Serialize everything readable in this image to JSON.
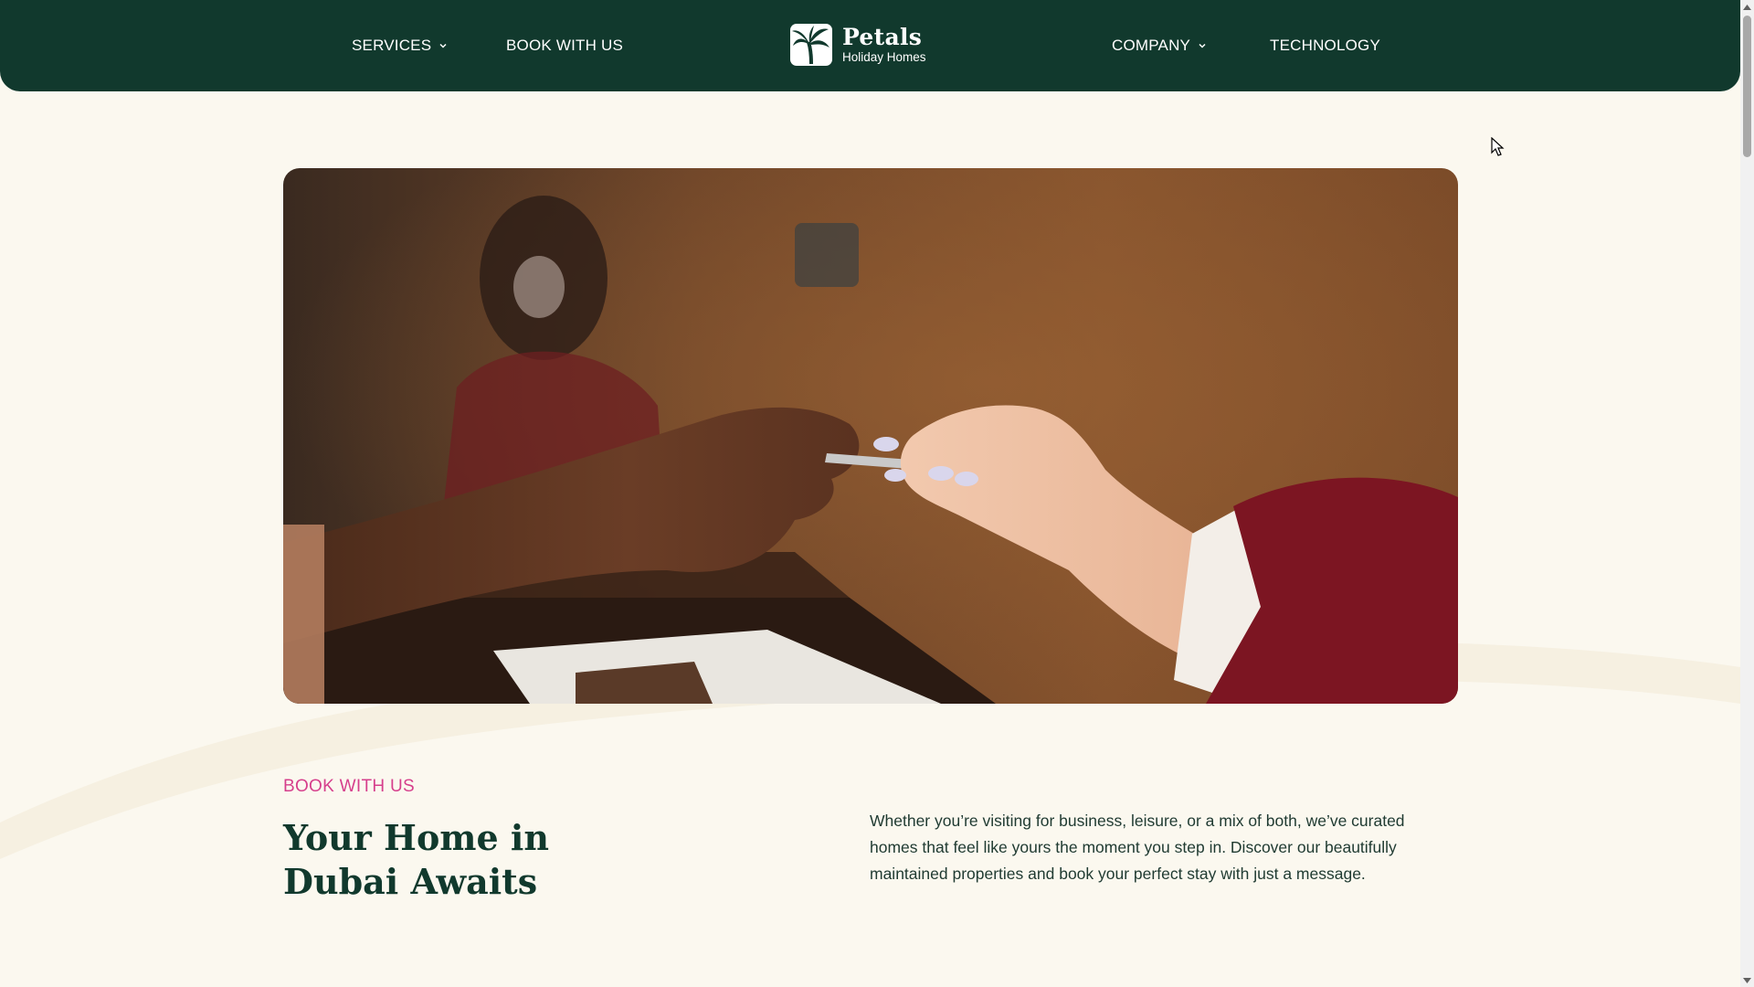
{
  "header": {
    "nav_left": [
      {
        "label": "SERVICES",
        "has_dropdown": true
      },
      {
        "label": "BOOK WITH US",
        "has_dropdown": false
      }
    ],
    "nav_right": [
      {
        "label": "COMPANY",
        "has_dropdown": true
      },
      {
        "label": "TECHNOLOGY",
        "has_dropdown": false
      }
    ],
    "logo": {
      "name": "Petals",
      "subtitle": "Holiday Homes",
      "icon": "palm-tree-logo-icon"
    }
  },
  "hero": {
    "image": "photo-card-handover"
  },
  "section": {
    "eyebrow": "BOOK WITH US",
    "headline": "Your Home in Dubai Awaits",
    "body": "Whether you’re visiting for business, leisure, or a mix of both, we’ve curated homes that feel like yours the moment you step in. Discover our beautifully maintained properties and book your perfect stay with just a message."
  },
  "colors": {
    "header_bg": "#11392d",
    "page_bg": "#fbf8ef",
    "accent_pink": "#d63f8c",
    "headline": "#11392d"
  },
  "icons": [
    "chevron-down-icon",
    "palm-tree-logo-icon",
    "scroll-up-arrow-icon",
    "scroll-down-arrow-icon",
    "mouse-cursor-icon"
  ]
}
